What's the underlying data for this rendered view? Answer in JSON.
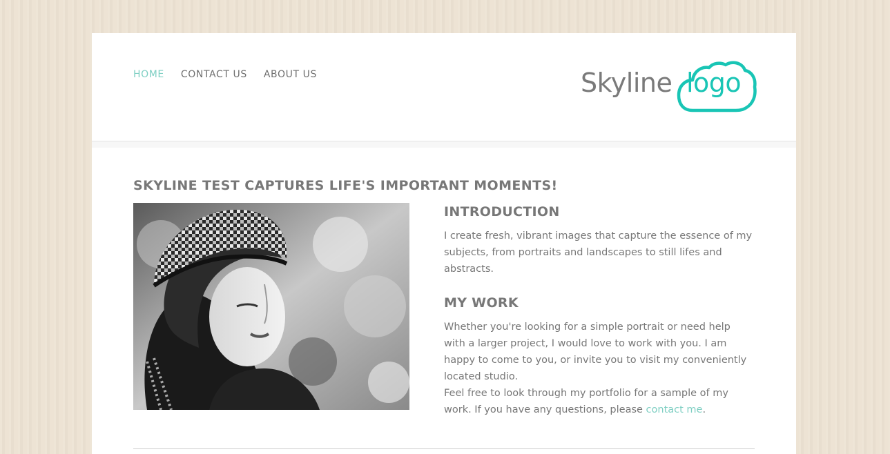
{
  "nav": {
    "items": [
      {
        "label": "HOME",
        "active": true
      },
      {
        "label": "CONTACT US",
        "active": false
      },
      {
        "label": "ABOUT US",
        "active": false
      }
    ]
  },
  "logo": {
    "text": "Skyline",
    "word": "logo",
    "text_color": "#7a7a7a",
    "accent_color": "#19c5b5"
  },
  "main": {
    "title": "SKYLINE TEST CAPTURES LIFE'S IMPORTANT MOMENTS!",
    "intro_heading": "INTRODUCTION",
    "intro_text": "I create fresh, vibrant images that capture the essence of my subjects, from portraits and landscapes to still lifes and abstracts.",
    "work_heading": "MY WORK",
    "work_text": "Whether you're looking for a simple portrait or need help with a larger project, I would love to work with you. I am happy to come to you, or invite you to visit my conveniently located studio.",
    "work_text2_before": "Feel free to look through my portfolio for a sample of my work. If you have any questions, please ",
    "contact_link": "contact me",
    "work_text2_after": "."
  },
  "colors": {
    "link_accent": "#7fcfc3",
    "body_text": "#777777",
    "background": "#ece2d2"
  }
}
